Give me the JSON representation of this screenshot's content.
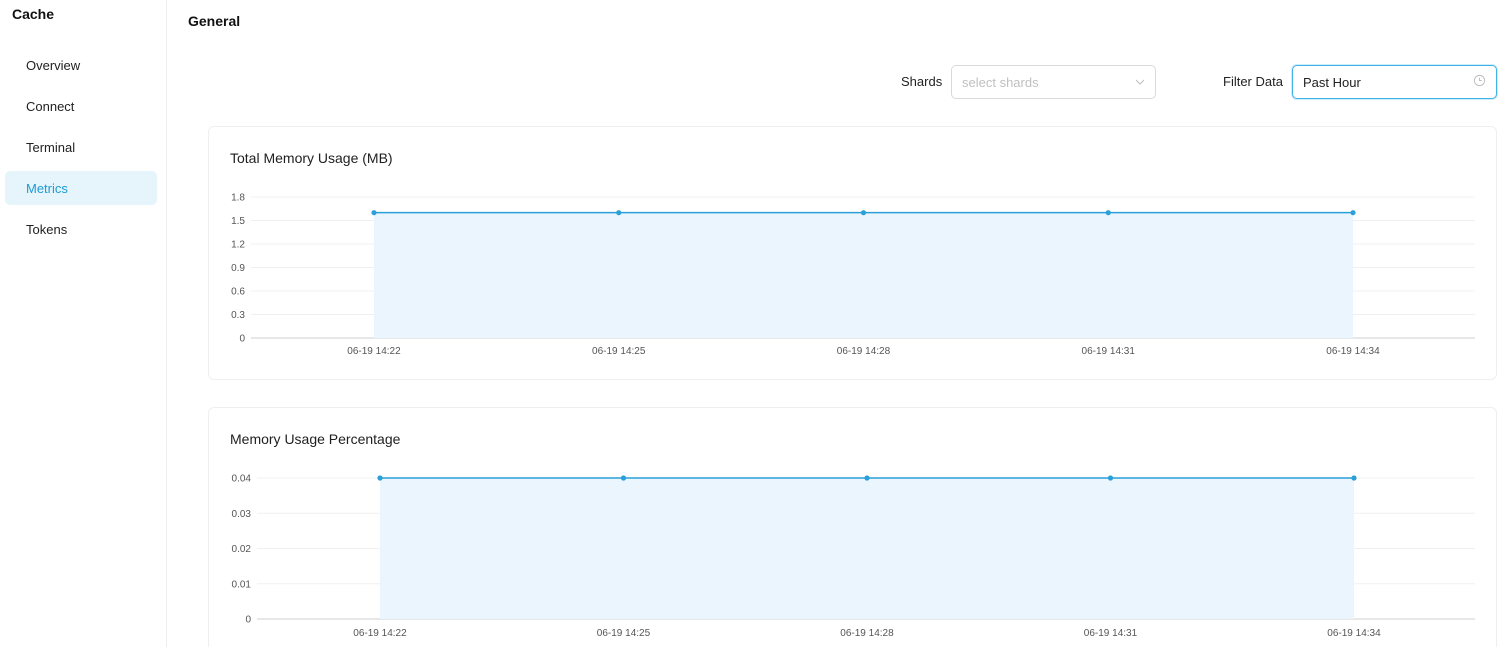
{
  "sidebar": {
    "title": "Cache",
    "items": [
      {
        "label": "Overview",
        "active": false
      },
      {
        "label": "Connect",
        "active": false
      },
      {
        "label": "Terminal",
        "active": false
      },
      {
        "label": "Metrics",
        "active": true
      },
      {
        "label": "Tokens",
        "active": false
      }
    ]
  },
  "main": {
    "title": "General",
    "filters": {
      "shards_label": "Shards",
      "shards_placeholder": "select shards",
      "filter_label": "Filter Data",
      "filter_value": "Past Hour"
    }
  },
  "colors": {
    "accent": "#1c9bd7",
    "line": "#2a9fd8",
    "area": "#eaf5fd",
    "active_bg": "#e6f4fb"
  },
  "chart_data": [
    {
      "type": "area",
      "title": "Total Memory Usage (MB)",
      "categories": [
        "06-19 14:22",
        "06-19 14:25",
        "06-19 14:28",
        "06-19 14:31",
        "06-19 14:34"
      ],
      "values": [
        1.6,
        1.6,
        1.6,
        1.6,
        1.6
      ],
      "yticks": [
        "0",
        "0.3",
        "0.6",
        "0.9",
        "1.2",
        "1.5",
        "1.8"
      ],
      "ylim": [
        0,
        1.8
      ],
      "grid": true,
      "legend": "none"
    },
    {
      "type": "area",
      "title": "Memory Usage Percentage",
      "categories": [
        "06-19 14:22",
        "06-19 14:25",
        "06-19 14:28",
        "06-19 14:31",
        "06-19 14:34"
      ],
      "values": [
        0.04,
        0.04,
        0.04,
        0.04,
        0.04
      ],
      "yticks": [
        "0",
        "0.01",
        "0.02",
        "0.03",
        "0.04"
      ],
      "ylim": [
        0,
        0.04
      ],
      "grid": true,
      "legend": "none"
    }
  ]
}
